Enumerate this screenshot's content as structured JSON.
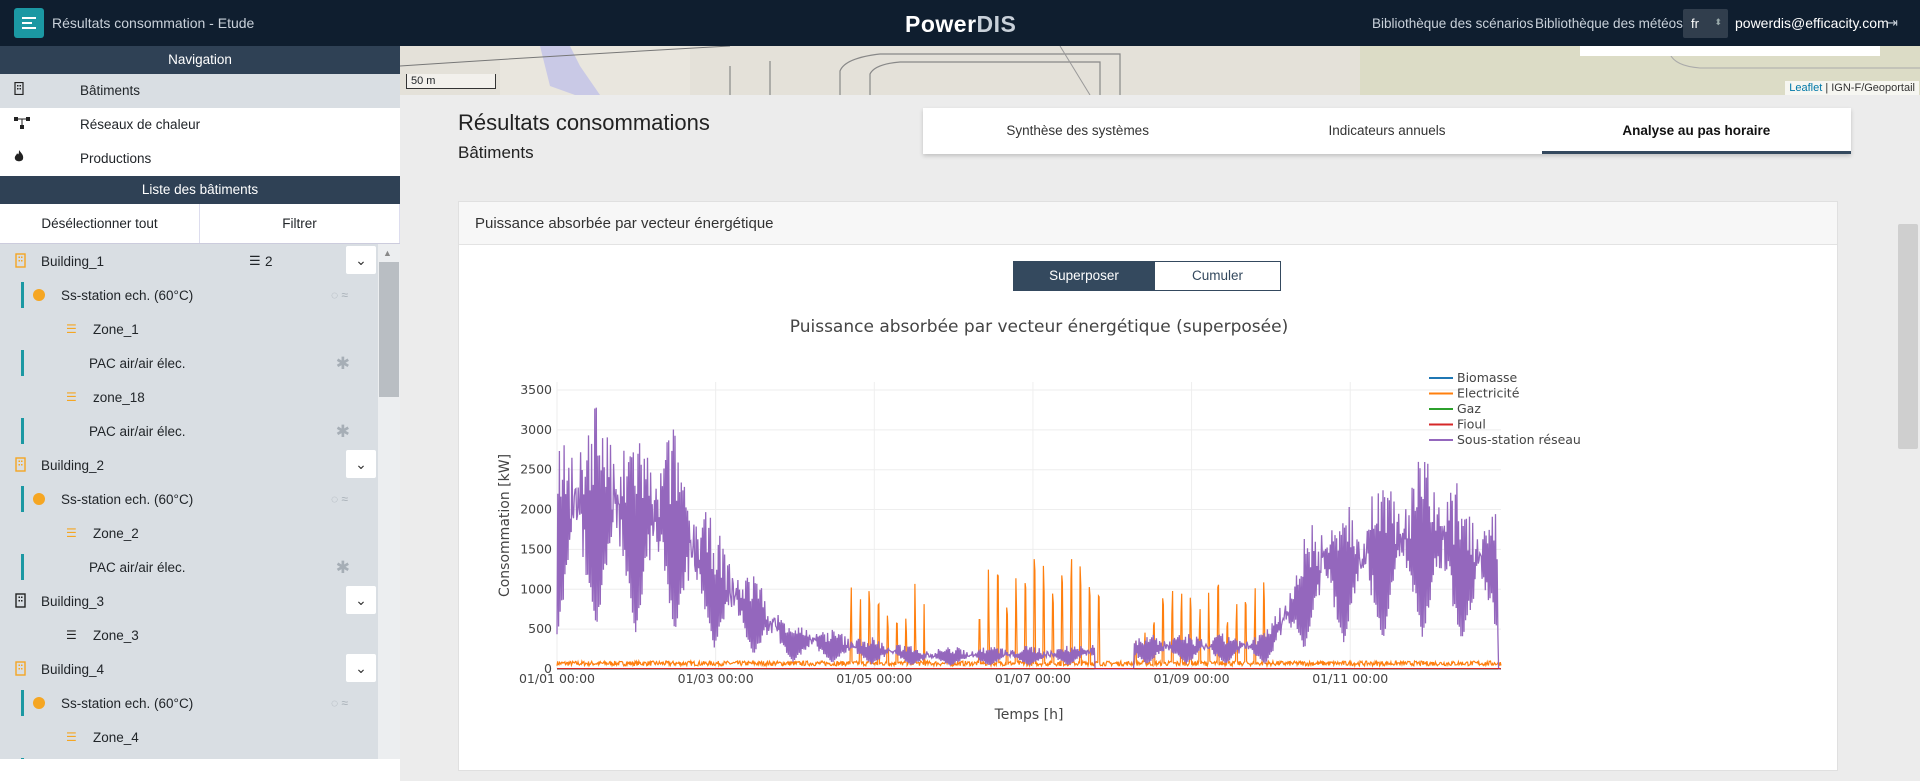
{
  "header": {
    "app_title": "Résultats consommation - Etude",
    "logo_power": "Power",
    "logo_dis": "DIS",
    "scenario_library": "Bibliothèque des scénarios",
    "weather_library": "Bibliothèque des météos",
    "language": "fr",
    "user_email": "powerdis@efficacity.com"
  },
  "sidebar": {
    "navigation_title": "Navigation",
    "nav_items": [
      {
        "label": "Bâtiments",
        "icon": "building-icon"
      },
      {
        "label": "Réseaux de chaleur",
        "icon": "network-icon"
      },
      {
        "label": "Productions",
        "icon": "flame-icon"
      }
    ],
    "list_title": "Liste des bâtiments",
    "deselect_all": "Désélectionner tout",
    "filter": "Filtrer",
    "buildings": [
      {
        "name": "Building_1",
        "badge_count": "2"
      },
      {
        "substation": "Ss-station ech. (60°C)"
      },
      {
        "zone": "Zone_1"
      },
      {
        "system": "PAC air/air élec."
      },
      {
        "zone": "zone_18"
      },
      {
        "system": "PAC air/air élec."
      },
      {
        "name": "Building_2"
      },
      {
        "substation": "Ss-station ech. (60°C)"
      },
      {
        "zone": "Zone_2"
      },
      {
        "system": "PAC air/air élec."
      },
      {
        "name": "Building_3"
      },
      {
        "zone": "Zone_3"
      },
      {
        "name": "Building_4"
      },
      {
        "substation": "Ss-station ech. (60°C)"
      },
      {
        "zone": "Zone_4"
      }
    ]
  },
  "map": {
    "scale": "50 m",
    "attribution_link": "Leaflet",
    "attribution_text": " | IGN-F/Geoportail"
  },
  "main": {
    "title": "Résultats consommations",
    "subtitle": "Bâtiments",
    "tabs": [
      {
        "label": "Synthèse des systèmes",
        "active": false
      },
      {
        "label": "Indicateurs annuels",
        "active": false
      },
      {
        "label": "Analyse au pas horaire",
        "active": true
      }
    ],
    "card_title": "Puissance absorbée par vecteur énergétique",
    "toggle_superpose": "Superposer",
    "toggle_cumulate": "Cumuler"
  },
  "chart_data": {
    "type": "line",
    "title": "Puissance absorbée par vecteur énergétique (superposée)",
    "xlabel": "Temps [h]",
    "ylabel": "Consommation [kW]",
    "x_ticks": [
      "01/01 00:00",
      "01/03 00:00",
      "01/05 00:00",
      "01/07 00:00",
      "01/09 00:00",
      "01/11 00:00"
    ],
    "y_ticks": [
      0,
      500,
      1000,
      1500,
      2000,
      2500,
      3000,
      3500
    ],
    "ylim": [
      0,
      3600
    ],
    "xlim_days": [
      0,
      360
    ],
    "legend_position": "right",
    "series": [
      {
        "name": "Biomasse",
        "color": "#1f77b4",
        "approx_level": 0
      },
      {
        "name": "Electricité",
        "color": "#ff7f0e",
        "approx_level": 60
      },
      {
        "name": "Gaz",
        "color": "#2ca02c",
        "approx_level": 0
      },
      {
        "name": "Fioul",
        "color": "#d62728",
        "approx_level": 0
      },
      {
        "name": "Sous-station réseau",
        "color": "#9467bd",
        "approx_peak": 3500
      }
    ],
    "envelope_note_sous_station": [
      {
        "day": 0,
        "max": 2900
      },
      {
        "day": 15,
        "max": 3500
      },
      {
        "day": 25,
        "max": 3100
      },
      {
        "day": 45,
        "max": 3050
      },
      {
        "day": 60,
        "max": 1800
      },
      {
        "day": 90,
        "max": 600
      },
      {
        "day": 140,
        "max": 280
      },
      {
        "day": 190,
        "max": 300
      },
      {
        "day": 230,
        "max": 450
      },
      {
        "day": 270,
        "max": 450
      },
      {
        "day": 290,
        "max": 2100
      },
      {
        "day": 330,
        "max": 2700
      },
      {
        "day": 359,
        "max": 2000
      }
    ],
    "electricite_spike_periods": [
      {
        "day_start": 110,
        "day_end": 140,
        "max": 1100
      },
      {
        "day_start": 160,
        "day_end": 182,
        "max": 1250
      },
      {
        "day_start": 180,
        "day_end": 209,
        "max": 1450
      },
      {
        "day_start": 220,
        "day_end": 230,
        "max": 650
      },
      {
        "day_start": 230,
        "day_end": 272,
        "max": 1150
      }
    ]
  }
}
